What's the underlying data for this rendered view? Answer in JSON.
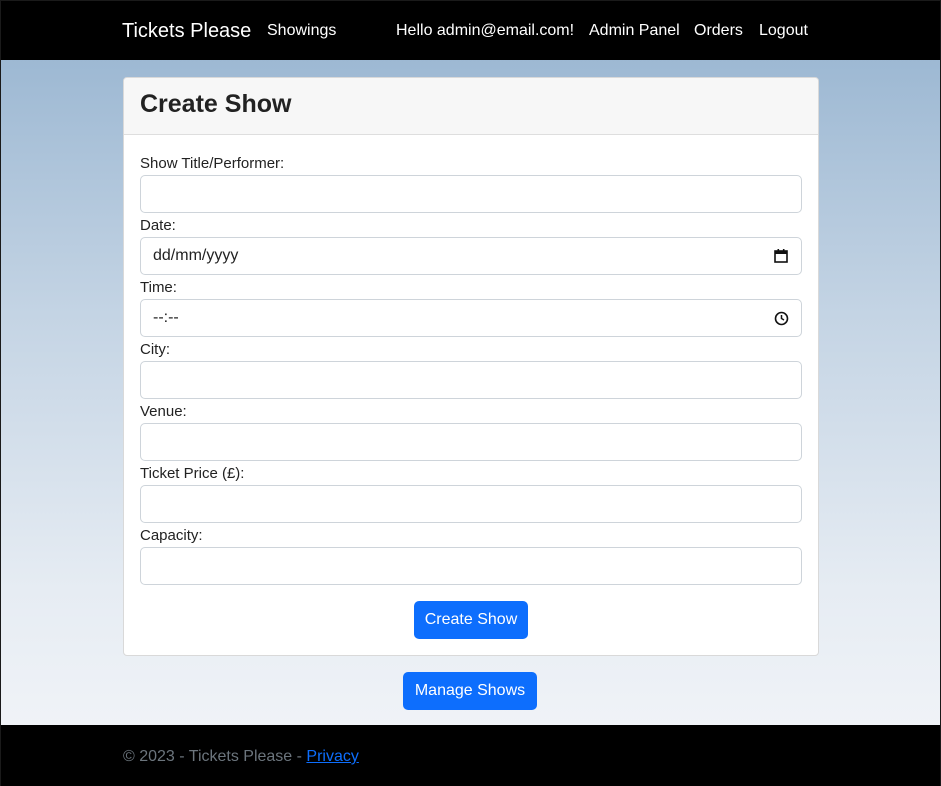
{
  "navbar": {
    "brand": "Tickets Please",
    "showings": "Showings",
    "greeting": "Hello admin@email.com!",
    "admin_panel": "Admin Panel",
    "orders": "Orders",
    "logout": "Logout"
  },
  "form": {
    "title": "Create Show",
    "fields": {
      "title_label": "Show Title/Performer:",
      "title_value": "",
      "date_label": "Date:",
      "date_placeholder": "dd/mm/yyyy",
      "time_label": "Time:",
      "time_placeholder": "--:--",
      "city_label": "City:",
      "city_value": "",
      "venue_label": "Venue:",
      "venue_value": "",
      "price_label": "Ticket Price (£):",
      "price_value": "",
      "capacity_label": "Capacity:",
      "capacity_value": ""
    },
    "submit_label": "Create Show"
  },
  "manage_label": "Manage Shows",
  "footer": {
    "text": "© 2023 - Tickets Please - ",
    "privacy": "Privacy"
  },
  "colors": {
    "primary": "#0d6efd",
    "navbar": "#000000"
  }
}
